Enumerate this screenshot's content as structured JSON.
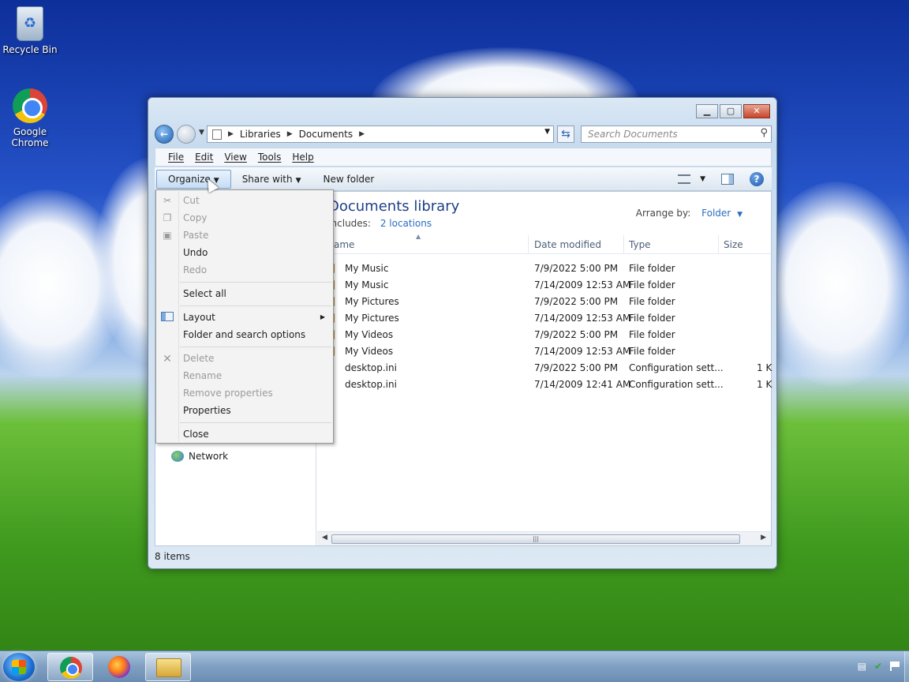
{
  "desktop": {
    "icons": [
      {
        "label": "Recycle Bin"
      },
      {
        "label": "Google Chrome"
      }
    ]
  },
  "explorer": {
    "address": {
      "crumbs": [
        "Libraries",
        "Documents"
      ],
      "search_placeholder": "Search Documents"
    },
    "menubar": {
      "file": "File",
      "edit": "Edit",
      "view": "View",
      "tools": "Tools",
      "help": "Help"
    },
    "toolbar": {
      "organize": "Organize",
      "share_with": "Share with",
      "new_folder": "New folder"
    },
    "library": {
      "title": "Documents library",
      "includes_label": "Includes:",
      "includes_link": "2 locations",
      "arrange_label": "Arrange by:",
      "arrange_value": "Folder"
    },
    "columns": {
      "name": "Name",
      "date": "Date modified",
      "type": "Type",
      "size": "Size"
    },
    "files": [
      {
        "name": "My Music",
        "date": "7/9/2022 5:00 PM",
        "type": "File folder",
        "size": "",
        "kind": "folder"
      },
      {
        "name": "My Music",
        "date": "7/14/2009 12:53 AM",
        "type": "File folder",
        "size": "",
        "kind": "folder"
      },
      {
        "name": "My Pictures",
        "date": "7/9/2022 5:00 PM",
        "type": "File folder",
        "size": "",
        "kind": "folder"
      },
      {
        "name": "My Pictures",
        "date": "7/14/2009 12:53 AM",
        "type": "File folder",
        "size": "",
        "kind": "folder"
      },
      {
        "name": "My Videos",
        "date": "7/9/2022 5:00 PM",
        "type": "File folder",
        "size": "",
        "kind": "folder"
      },
      {
        "name": "My Videos",
        "date": "7/14/2009 12:53 AM",
        "type": "File folder",
        "size": "",
        "kind": "folder"
      },
      {
        "name": "desktop.ini",
        "date": "7/9/2022 5:00 PM",
        "type": "Configuration sett...",
        "size": "1 K",
        "kind": "file"
      },
      {
        "name": "desktop.ini",
        "date": "7/14/2009 12:41 AM",
        "type": "Configuration sett...",
        "size": "1 K",
        "kind": "file"
      }
    ],
    "navpane": {
      "network": "Network"
    },
    "status": "8 items"
  },
  "organize_menu": {
    "cut": "Cut",
    "copy": "Copy",
    "paste": "Paste",
    "undo": "Undo",
    "redo": "Redo",
    "select_all": "Select all",
    "layout": "Layout",
    "folder_options": "Folder and search options",
    "delete": "Delete",
    "rename": "Rename",
    "remove_properties": "Remove properties",
    "properties": "Properties",
    "close": "Close"
  },
  "colors": {
    "library_title": "#1e3f8a",
    "link": "#2a6cc4",
    "disabled_text": "#9a9a9a"
  }
}
